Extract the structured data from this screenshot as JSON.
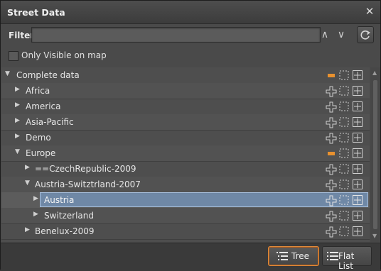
{
  "window": {
    "title": "Street Data",
    "close_symbol": "✕"
  },
  "filter": {
    "label": "Filter",
    "value": "",
    "placeholder": "",
    "up_symbol": "∧",
    "down_symbol": "∨"
  },
  "visible_only": {
    "label": "Only Visible on map",
    "checked": false
  },
  "tree": {
    "rows": [
      {
        "label": "Complete data",
        "expanded": true,
        "selected": false,
        "partial": true
      },
      {
        "label": "Africa",
        "expanded": false,
        "selected": false,
        "partial": false
      },
      {
        "label": "America",
        "expanded": false,
        "selected": false,
        "partial": false
      },
      {
        "label": "Asia-Pacific",
        "expanded": false,
        "selected": false,
        "partial": false
      },
      {
        "label": "Demo",
        "expanded": false,
        "selected": false,
        "partial": false
      },
      {
        "label": "Europe",
        "expanded": true,
        "selected": false,
        "partial": true
      },
      {
        "label": "==CzechRepublic-2009",
        "expanded": false,
        "selected": false,
        "partial": false
      },
      {
        "label": "Austria-Switztrland-2007",
        "expanded": true,
        "selected": false,
        "partial": false
      },
      {
        "label": "Austria",
        "expanded": false,
        "selected": true,
        "partial": false
      },
      {
        "label": "Switzerland",
        "expanded": false,
        "selected": false,
        "partial": false
      },
      {
        "label": "Benelux-2009",
        "expanded": false,
        "selected": false,
        "partial": false
      }
    ]
  },
  "footer": {
    "tree_label": "Tree",
    "flat_list_label": "Flat List",
    "active_view": "Tree"
  },
  "colors": {
    "accent_orange": "#e8912f",
    "selection": "#6f88a6"
  }
}
